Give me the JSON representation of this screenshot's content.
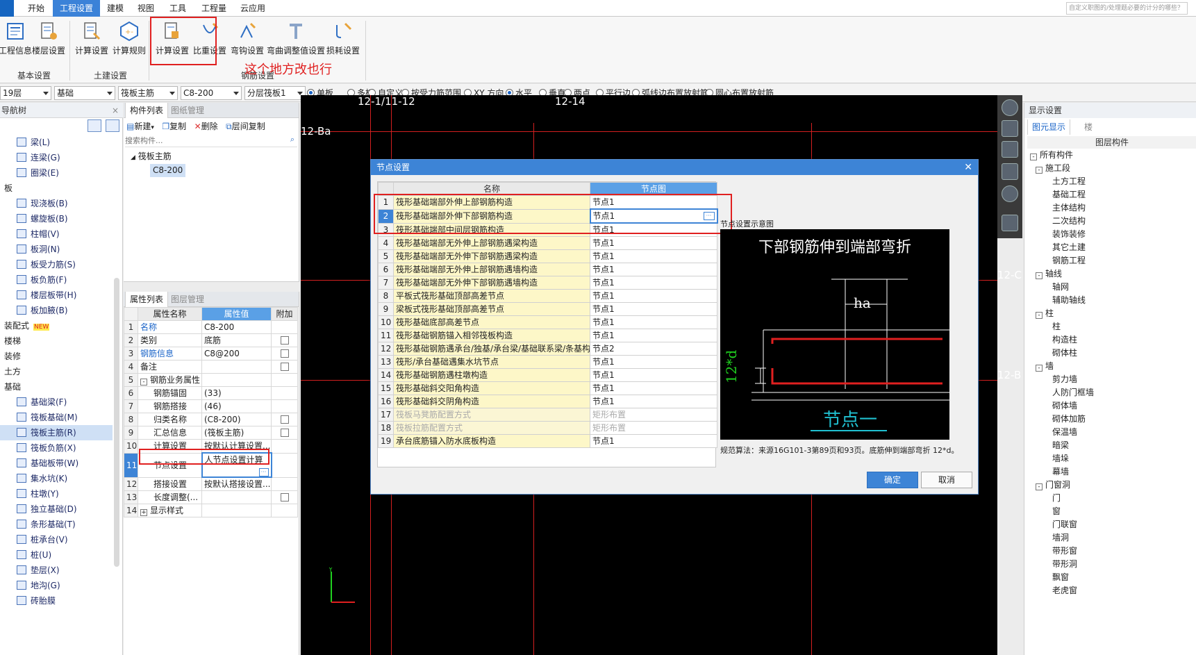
{
  "menu": {
    "items": [
      "开始",
      "工程设置",
      "建模",
      "视图",
      "工具",
      "工程量",
      "云应用"
    ],
    "active_index": 1,
    "search_hint": "自定义职图的/处理题必要的计分的哪些？"
  },
  "ribbon": {
    "buttons": [
      "工程信息",
      "楼层设置",
      "计算设置",
      "计算规则",
      "计算设置",
      "比重设置",
      "弯钩设置",
      "弯曲调整值设置",
      "损耗设置"
    ],
    "groups": [
      "基本设置",
      "土建设置",
      "钢筋设置"
    ],
    "annotation": "这个地方改也行"
  },
  "toolbar": {
    "combos": [
      "19层",
      "基础",
      "筏板主筋",
      "C8-200",
      "分层筏板1"
    ],
    "radios": [
      {
        "label": "单板",
        "on": true
      },
      {
        "label": "多板",
        "on": false
      },
      {
        "label": "自定义",
        "on": false
      },
      {
        "label": "按受力筋范围",
        "on": false
      },
      {
        "label": "XY 方向",
        "on": false
      },
      {
        "label": "水平",
        "on": true
      },
      {
        "label": "垂直",
        "on": false
      },
      {
        "label": "两点",
        "on": false
      },
      {
        "label": "平行边",
        "on": false
      },
      {
        "label": "弧线边布置放射筋",
        "on": false
      },
      {
        "label": "圆心布置放射筋",
        "on": false
      }
    ]
  },
  "nav": {
    "title": "导航树",
    "items": [
      {
        "label": "梁(L)",
        "type": "item"
      },
      {
        "label": "连梁(G)",
        "type": "item"
      },
      {
        "label": "圈梁(E)",
        "type": "item"
      },
      {
        "label": "板",
        "type": "cat"
      },
      {
        "label": "现浇板(B)",
        "type": "item"
      },
      {
        "label": "螺旋板(B)",
        "type": "item"
      },
      {
        "label": "柱帽(V)",
        "type": "item"
      },
      {
        "label": "板洞(N)",
        "type": "item"
      },
      {
        "label": "板受力筋(S)",
        "type": "item"
      },
      {
        "label": "板负筋(F)",
        "type": "item"
      },
      {
        "label": "楼层板带(H)",
        "type": "item"
      },
      {
        "label": "板加腋(B)",
        "type": "item"
      },
      {
        "label": "装配式",
        "type": "cat",
        "badge": "NEW"
      },
      {
        "label": "楼梯",
        "type": "cat"
      },
      {
        "label": "装修",
        "type": "cat"
      },
      {
        "label": "土方",
        "type": "cat"
      },
      {
        "label": "基础",
        "type": "cat"
      },
      {
        "label": "基础梁(F)",
        "type": "item"
      },
      {
        "label": "筏板基础(M)",
        "type": "item"
      },
      {
        "label": "筏板主筋(R)",
        "type": "item",
        "sel": true
      },
      {
        "label": "筏板负筋(X)",
        "type": "item"
      },
      {
        "label": "基础板带(W)",
        "type": "item"
      },
      {
        "label": "集水坑(K)",
        "type": "item"
      },
      {
        "label": "柱墩(Y)",
        "type": "item"
      },
      {
        "label": "独立基础(D)",
        "type": "item"
      },
      {
        "label": "条形基础(T)",
        "type": "item"
      },
      {
        "label": "桩承台(V)",
        "type": "item"
      },
      {
        "label": "桩(U)",
        "type": "item"
      },
      {
        "label": "垫层(X)",
        "type": "item"
      },
      {
        "label": "地沟(G)",
        "type": "item"
      },
      {
        "label": "砖胎膜",
        "type": "item"
      }
    ]
  },
  "component_list": {
    "tabs": [
      "构件列表",
      "图纸管理"
    ],
    "actions": [
      "新建",
      "复制",
      "删除",
      "层间复制"
    ],
    "search_placeholder": "搜索构件...",
    "group": "筏板主筋",
    "selected": "C8-200"
  },
  "properties": {
    "tabs": [
      "属性列表",
      "图层管理"
    ],
    "headers": [
      "属性名称",
      "属性值",
      "附加"
    ],
    "rows": [
      {
        "n": "1",
        "name": "名称",
        "value": "C8-200",
        "chk": false,
        "link": true
      },
      {
        "n": "2",
        "name": "类别",
        "value": "底筋",
        "chk": true
      },
      {
        "n": "3",
        "name": "钢筋信息",
        "value": "C8@200",
        "chk": true,
        "link": true
      },
      {
        "n": "4",
        "name": "备注",
        "value": "",
        "chk": true
      },
      {
        "n": "5",
        "name": "钢筋业务属性",
        "value": "",
        "chk": false,
        "group": "-"
      },
      {
        "n": "6",
        "name": "钢筋锚固",
        "value": "(33)",
        "chk": false,
        "indent": true
      },
      {
        "n": "7",
        "name": "钢筋搭接",
        "value": "(46)",
        "chk": false,
        "indent": true
      },
      {
        "n": "8",
        "name": "归类名称",
        "value": "(C8-200)",
        "chk": true,
        "indent": true
      },
      {
        "n": "9",
        "name": "汇总信息",
        "value": "(筏板主筋)",
        "chk": true,
        "indent": true
      },
      {
        "n": "10",
        "name": "计算设置",
        "value": "按默认计算设置...",
        "chk": false,
        "indent": true
      },
      {
        "n": "11",
        "name": "节点设置",
        "value": "人节点设置计算",
        "chk": false,
        "indent": true,
        "sel": true
      },
      {
        "n": "12",
        "name": "搭接设置",
        "value": "按默认搭接设置...",
        "chk": false,
        "indent": true
      },
      {
        "n": "13",
        "name": "长度调整(...",
        "value": "",
        "chk": true,
        "indent": true
      },
      {
        "n": "14",
        "name": "显示样式",
        "value": "",
        "chk": false,
        "group": "+"
      }
    ]
  },
  "canvas": {
    "labels": [
      "12-1/11-12",
      "12-14",
      "12-Ba",
      "12-C",
      "12-B"
    ]
  },
  "right_panel": {
    "title": "显示设置",
    "tabs": [
      "图元显示",
      "楼"
    ],
    "header": "图层构件",
    "items": [
      {
        "label": "所有构件",
        "lvl": 0,
        "pm": "-"
      },
      {
        "label": "施工段",
        "lvl": 1,
        "pm": "-"
      },
      {
        "label": "土方工程",
        "lvl": 2
      },
      {
        "label": "基础工程",
        "lvl": 2
      },
      {
        "label": "主体结构",
        "lvl": 2
      },
      {
        "label": "二次结构",
        "lvl": 2
      },
      {
        "label": "装饰装修",
        "lvl": 2
      },
      {
        "label": "其它土建",
        "lvl": 2
      },
      {
        "label": "钢筋工程",
        "lvl": 2
      },
      {
        "label": "轴线",
        "lvl": 1,
        "pm": "-"
      },
      {
        "label": "轴网",
        "lvl": 2
      },
      {
        "label": "辅助轴线",
        "lvl": 2
      },
      {
        "label": "柱",
        "lvl": 1,
        "pm": "-"
      },
      {
        "label": "柱",
        "lvl": 2
      },
      {
        "label": "构造柱",
        "lvl": 2
      },
      {
        "label": "砌体柱",
        "lvl": 2
      },
      {
        "label": "墙",
        "lvl": 1,
        "pm": "-"
      },
      {
        "label": "剪力墙",
        "lvl": 2
      },
      {
        "label": "人防门框墙",
        "lvl": 2
      },
      {
        "label": "砌体墙",
        "lvl": 2
      },
      {
        "label": "砌体加筋",
        "lvl": 2
      },
      {
        "label": "保温墙",
        "lvl": 2
      },
      {
        "label": "暗梁",
        "lvl": 2
      },
      {
        "label": "墙垛",
        "lvl": 2
      },
      {
        "label": "幕墙",
        "lvl": 2
      },
      {
        "label": "门窗洞",
        "lvl": 1,
        "pm": "-"
      },
      {
        "label": "门",
        "lvl": 2
      },
      {
        "label": "窗",
        "lvl": 2
      },
      {
        "label": "门联窗",
        "lvl": 2
      },
      {
        "label": "墙洞",
        "lvl": 2
      },
      {
        "label": "带形窗",
        "lvl": 2
      },
      {
        "label": "带形洞",
        "lvl": 2
      },
      {
        "label": "飘窗",
        "lvl": 2
      },
      {
        "label": "老虎窗",
        "lvl": 2
      }
    ]
  },
  "dialog": {
    "title": "节点设置",
    "col_name": "名称",
    "col_node": "节点图",
    "rows": [
      {
        "n": "1",
        "name": "筏形基础端部外伸上部钢筋构造",
        "val": "节点1"
      },
      {
        "n": "2",
        "name": "筏形基础端部外伸下部钢筋构造",
        "val": "节点1",
        "sel": true
      },
      {
        "n": "3",
        "name": "筏形基础端部中间层钢筋构造",
        "val": "节点1"
      },
      {
        "n": "4",
        "name": "筏形基础端部无外伸上部钢筋遇梁构造",
        "val": "节点1"
      },
      {
        "n": "5",
        "name": "筏形基础端部无外伸下部钢筋遇梁构造",
        "val": "节点1"
      },
      {
        "n": "6",
        "name": "筏形基础端部无外伸上部钢筋遇墙构造",
        "val": "节点1"
      },
      {
        "n": "7",
        "name": "筏形基础端部无外伸下部钢筋遇墙构造",
        "val": "节点1"
      },
      {
        "n": "8",
        "name": "平板式筏形基础顶部高差节点",
        "val": "节点1"
      },
      {
        "n": "9",
        "name": "梁板式筏形基础顶部高差节点",
        "val": "节点1"
      },
      {
        "n": "10",
        "name": "筏形基础底部高差节点",
        "val": "节点1"
      },
      {
        "n": "11",
        "name": "筏形基础钢筋锚入相邻筏板构造",
        "val": "节点1"
      },
      {
        "n": "12",
        "name": "筏形基础钢筋遇承台/独基/承台梁/基础联系梁/条基构造",
        "val": "节点2"
      },
      {
        "n": "13",
        "name": "筏形/承台基础遇集水坑节点",
        "val": "节点1"
      },
      {
        "n": "14",
        "name": "筏形基础钢筋遇柱墩构造",
        "val": "节点1"
      },
      {
        "n": "15",
        "name": "筏形基础斜交阳角构造",
        "val": "节点1"
      },
      {
        "n": "16",
        "name": "筏形基础斜交阴角构造",
        "val": "节点1"
      },
      {
        "n": "17",
        "name": "筏板马凳筋配置方式",
        "val": "矩形布置",
        "gray": true
      },
      {
        "n": "18",
        "name": "筏板拉筋配置方式",
        "val": "矩形布置",
        "gray": true
      },
      {
        "n": "19",
        "name": "承台底筋锚入防水底板构造",
        "val": "节点1"
      }
    ],
    "diagram_caption": "节点设置示意图",
    "diagram_title": "下部钢筋伸到端部弯折",
    "diagram_ha": "ha",
    "diagram_12d": "12*d",
    "diagram_node": "节点一",
    "rule_text": "规范算法：来源16G101-3第89页和93页。底筋伸到端部弯折 12*d。",
    "ok": "确定",
    "cancel": "取消"
  }
}
